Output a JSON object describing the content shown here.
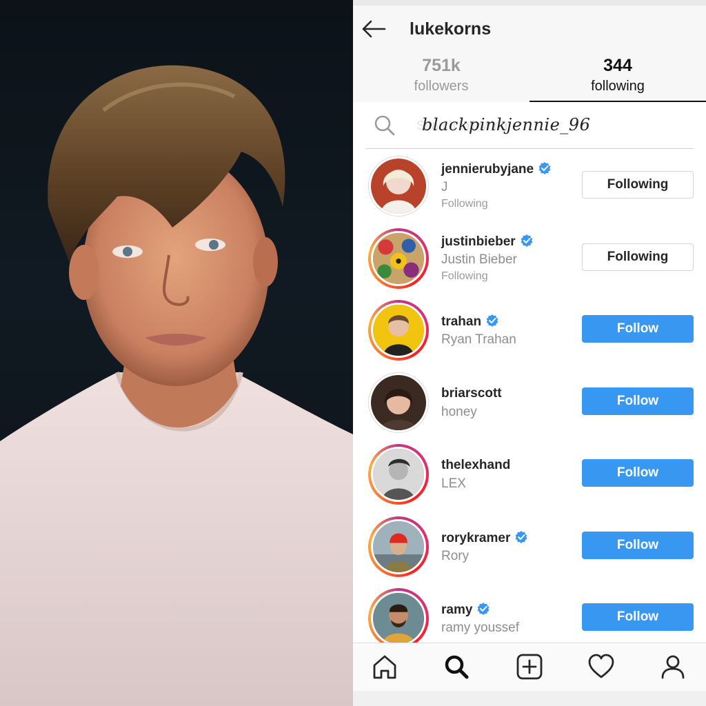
{
  "profile": {
    "username": "lukekorns",
    "followers_count": "751k",
    "followers_label": "followers",
    "following_count": "344",
    "following_label": "following"
  },
  "search": {
    "placeholder": "Search following",
    "handwritten_text": "blackpinkjennie_96"
  },
  "accounts": [
    {
      "username": "jennierubyjane",
      "verified": true,
      "full_name": "J",
      "status": "Following",
      "button": "Following",
      "story_ring": false
    },
    {
      "username": "justinbieber",
      "verified": true,
      "full_name": "Justin Bieber",
      "status": "Following",
      "button": "Following",
      "story_ring": true
    },
    {
      "username": "trahan",
      "verified": true,
      "full_name": "Ryan Trahan",
      "status": "",
      "button": "Follow",
      "story_ring": true
    },
    {
      "username": "briarscott",
      "verified": false,
      "full_name": "honey",
      "status": "",
      "button": "Follow",
      "story_ring": false
    },
    {
      "username": "thelexhand",
      "verified": false,
      "full_name": "LEX",
      "status": "",
      "button": "Follow",
      "story_ring": true
    },
    {
      "username": "rorykramer",
      "verified": true,
      "full_name": "Rory",
      "status": "",
      "button": "Follow",
      "story_ring": true
    },
    {
      "username": "ramy",
      "verified": true,
      "full_name": "ramy youssef",
      "status": "",
      "button": "Follow",
      "story_ring": true
    }
  ],
  "nav": [
    "home-icon",
    "search-icon",
    "add-post-icon",
    "activity-heart-icon",
    "profile-icon"
  ],
  "colors": {
    "follow_blue": "#3897f0",
    "verified_blue": "#3897f0",
    "story_ring": "#e1306c"
  }
}
